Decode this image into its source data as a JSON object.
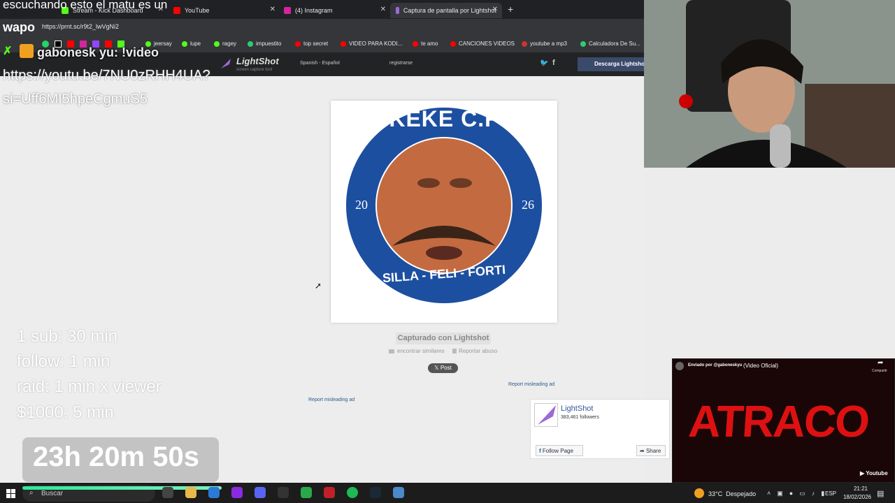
{
  "browser": {
    "tabs": [
      {
        "label": "Stream - Kick Dashboard",
        "color": "#53fc18"
      },
      {
        "label": "YouTube",
        "color": "#ff0000"
      },
      {
        "label": "(4) Instagram",
        "color": "#d6249f"
      },
      {
        "label": "Captura de pantalla por Lightshot",
        "color": "#9b6ad8"
      }
    ],
    "new_tab": "+",
    "url": "https://prnt.sc/r9t2_lwVgNi2",
    "bookmarks": [
      {
        "label": "jeersay",
        "color": "#53fc18"
      },
      {
        "label": "lupe",
        "color": "#53fc18"
      },
      {
        "label": "ragey",
        "color": "#53fc18"
      },
      {
        "label": "impuestito",
        "color": "#2ecc71"
      },
      {
        "label": "top secret",
        "color": "#ff0000"
      },
      {
        "label": "VIDEO PARA KODI...",
        "color": "#ff0000"
      },
      {
        "label": "te amo",
        "color": "#ff0000"
      },
      {
        "label": "CANCIONES VIDEOS",
        "color": "#ff0000"
      },
      {
        "label": "youtube a mp3",
        "color": "#cc3333"
      },
      {
        "label": "Calculadora De Su...",
        "color": "#2ecc71"
      }
    ]
  },
  "lightshot": {
    "logo": "LightShot",
    "tagline": "screen capture tool",
    "language": "Spanish - Español",
    "register": "registrarse",
    "download": "Descarga Lightshot",
    "captured_with": "Capturado con Lightshot",
    "find_similar": "encontrar similares",
    "report_abuse": "Reportar abuso",
    "post": "Post",
    "misleading_ad_1": "Report misleading ad",
    "misleading_ad_2": "Report misleading ad",
    "badge": {
      "top": "KEKE C.F",
      "bottom": "SILLA - FELI - FORTI",
      "left": "20",
      "right": "26"
    },
    "facebook": {
      "name": "LightShot",
      "followers": "383,461 followers",
      "follow": "Follow Page",
      "share": "Share"
    }
  },
  "overlay": {
    "chat_top": "escuchando esto el matu es un",
    "user_tag": "wapo",
    "chat_user": "gabonesk yu: !video",
    "chat_link_1": "https://youtu.be/7NU0zRHH4UA?",
    "chat_link_2": "si=Uff6MI5hpeCgmuS5",
    "rules": [
      "1 sub: 30 min",
      "follow: 1 min",
      "raid: 1 min x viewer",
      "$1000: 5 min"
    ],
    "timer": "23h 20m 50s"
  },
  "mini_player": {
    "sender": "Enviado por @gaboneskyu",
    "title": "(Video Oficial)",
    "share": "Compartir",
    "big_text": "ATRACO",
    "brand": "Youtube"
  },
  "taskbar": {
    "search": "Buscar",
    "weather": "33°C  Despejado",
    "lang": "ESP",
    "time": "21:21",
    "date": "18/02/2026"
  }
}
